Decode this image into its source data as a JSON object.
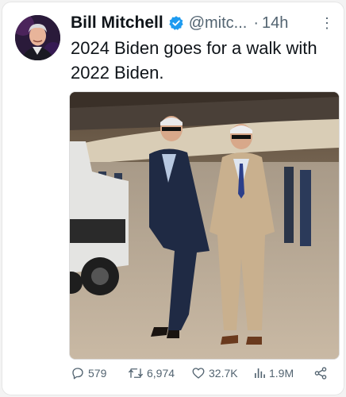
{
  "tweet": {
    "author_name": "Bill Mitchell",
    "handle": "@mitc...",
    "separator": "·",
    "time": "14h",
    "more": "⋮",
    "text": "2024 Biden goes for a walk with 2022 Biden."
  },
  "actions": {
    "replies": "579",
    "retweets": "6,974",
    "likes": "32.7K",
    "views": "1.9M"
  },
  "icons": {
    "avatar": "avatar",
    "verified": "verified-badge-icon",
    "reply": "reply-icon",
    "retweet": "retweet-icon",
    "like": "heart-icon",
    "views": "views-icon",
    "share": "share-icon"
  },
  "colors": {
    "verified": "#1d9bf0",
    "text": "#0f1419",
    "secondary": "#536471"
  }
}
